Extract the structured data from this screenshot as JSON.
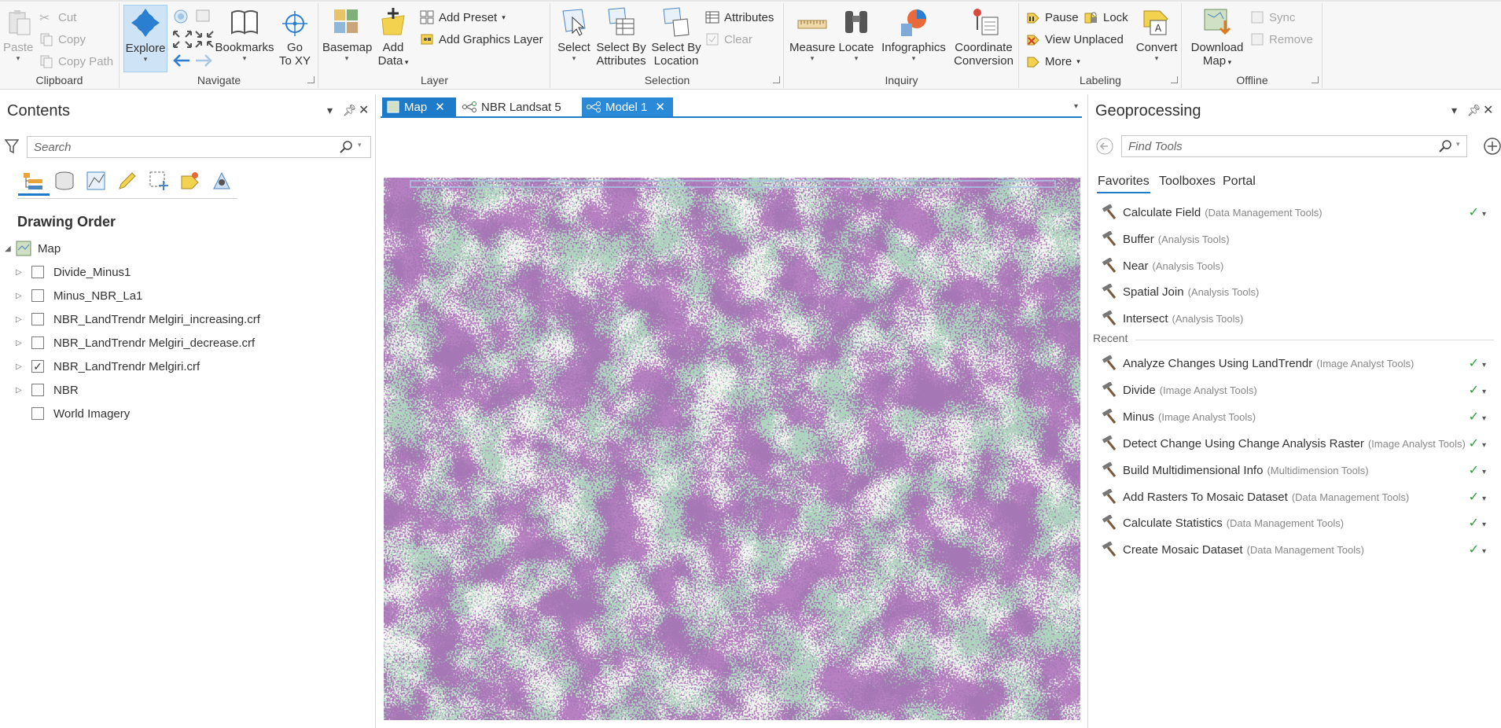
{
  "ribbon": {
    "clipboard": {
      "title": "Clipboard",
      "paste": "Paste",
      "cut": "Cut",
      "copy": "Copy",
      "copy_path": "Copy Path"
    },
    "navigate": {
      "title": "Navigate",
      "explore": "Explore",
      "bookmarks": "Bookmarks",
      "go_to_xy_line1": "Go",
      "go_to_xy_line2": "To XY"
    },
    "layer": {
      "title": "Layer",
      "basemap": "Basemap",
      "add_data_line1": "Add",
      "add_data_line2": "Data",
      "add_preset": "Add Preset",
      "add_graphics_layer": "Add Graphics Layer"
    },
    "selection": {
      "title": "Selection",
      "select": "Select",
      "select_by_attributes_line1": "Select By",
      "select_by_attributes_line2": "Attributes",
      "select_by_location_line1": "Select By",
      "select_by_location_line2": "Location",
      "attributes": "Attributes",
      "clear": "Clear"
    },
    "inquiry": {
      "title": "Inquiry",
      "measure": "Measure",
      "locate": "Locate",
      "infographics": "Infographics",
      "coordinate_line1": "Coordinate",
      "coordinate_line2": "Conversion"
    },
    "labeling": {
      "title": "Labeling",
      "pause": "Pause",
      "lock": "Lock",
      "view_unplaced": "View Unplaced",
      "more": "More",
      "convert": "Convert"
    },
    "offline": {
      "title": "Offline",
      "download_line1": "Download",
      "download_line2": "Map",
      "sync": "Sync",
      "remove": "Remove"
    }
  },
  "contents": {
    "title": "Contents",
    "search_placeholder": "Search",
    "section_title": "Drawing Order",
    "map_label": "Map",
    "layers": [
      {
        "name": "Divide_Minus1",
        "checked": false
      },
      {
        "name": "Minus_NBR_La1",
        "checked": false
      },
      {
        "name": "NBR_LandTrendr Melgiri_increasing.crf",
        "checked": false
      },
      {
        "name": "NBR_LandTrendr Melgiri_decrease.crf",
        "checked": false
      },
      {
        "name": "NBR_LandTrendr Melgiri.crf",
        "checked": true
      },
      {
        "name": "NBR",
        "checked": false
      },
      {
        "name": "World Imagery",
        "checked": false
      }
    ],
    "check_mark": "✓"
  },
  "tabs": [
    {
      "label": "Map"
    },
    {
      "label": "NBR Landsat 5"
    },
    {
      "label": "Model 1"
    }
  ],
  "geoprocessing": {
    "title": "Geoprocessing",
    "search_placeholder": "Find Tools",
    "tabs": [
      "Favorites",
      "Toolboxes",
      "Portal"
    ],
    "recent_label": "Recent",
    "favorites": [
      {
        "name": "Calculate Field",
        "toolbox": "(Data Management Tools)",
        "status": "✓"
      },
      {
        "name": "Buffer",
        "toolbox": "(Analysis Tools)",
        "status": ""
      },
      {
        "name": "Near",
        "toolbox": "(Analysis Tools)",
        "status": ""
      },
      {
        "name": "Spatial Join",
        "toolbox": "(Analysis Tools)",
        "status": ""
      },
      {
        "name": "Intersect",
        "toolbox": "(Analysis Tools)",
        "status": ""
      }
    ],
    "recent": [
      {
        "name": "Analyze Changes Using LandTrendr",
        "toolbox": "(Image Analyst Tools)",
        "status": "✓"
      },
      {
        "name": "Divide",
        "toolbox": "(Image Analyst Tools)",
        "status": "✓"
      },
      {
        "name": "Minus",
        "toolbox": "(Image Analyst Tools)",
        "status": "✓"
      },
      {
        "name": "Detect Change Using Change Analysis Raster",
        "toolbox": "(Image Analyst Tools)",
        "status": "✓"
      },
      {
        "name": "Build Multidimensional Info",
        "toolbox": "(Multidimension Tools)",
        "status": "✓"
      },
      {
        "name": "Add Rasters To Mosaic Dataset",
        "toolbox": "(Data Management Tools)",
        "status": "✓"
      },
      {
        "name": "Calculate Statistics",
        "toolbox": "(Data Management Tools)",
        "status": "✓"
      },
      {
        "name": "Create Mosaic Dataset",
        "toolbox": "(Data Management Tools)",
        "status": "✓"
      }
    ]
  },
  "colors": {
    "accent": "#1e7bc9",
    "change_purple": "#5a1a6e",
    "change_green": "#2e7d4f",
    "success": "#2e9a3a"
  }
}
